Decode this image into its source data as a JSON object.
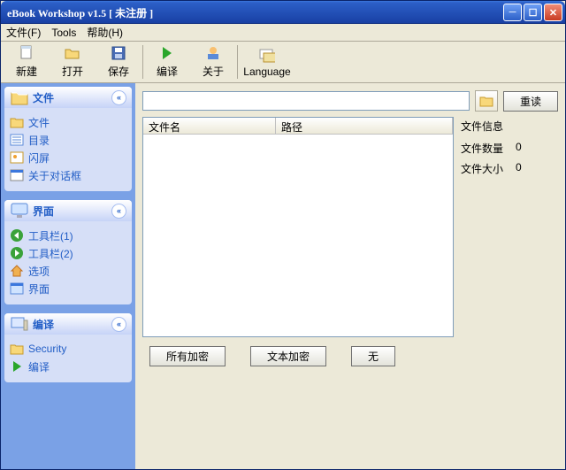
{
  "title": "eBook Workshop v1.5 [ 未注册 ]",
  "menu": {
    "file": "文件(F)",
    "tools": "Tools",
    "help": "帮助(H)"
  },
  "toolbar": {
    "new": "新建",
    "open": "打开",
    "save": "保存",
    "compile": "编译",
    "about": "关于",
    "language": "Language"
  },
  "sidebar": {
    "files": {
      "title": "文件",
      "items": [
        "文件",
        "目录",
        "闪屏",
        "关于对话框"
      ]
    },
    "ui": {
      "title": "界面",
      "items": [
        "工具栏(1)",
        "工具栏(2)",
        "选项",
        "界面"
      ]
    },
    "compile": {
      "title": "编译",
      "items": [
        "Security",
        "编译"
      ]
    }
  },
  "main": {
    "path_value": "",
    "reread": "重读",
    "cols": {
      "name": "文件名",
      "path": "路径"
    },
    "info": {
      "header": "文件信息",
      "count_label": "文件数量",
      "count_value": "0",
      "size_label": "文件大小",
      "size_value": "0"
    },
    "buttons": {
      "encrypt_all": "所有加密",
      "encrypt_text": "文本加密",
      "none": "无"
    }
  }
}
